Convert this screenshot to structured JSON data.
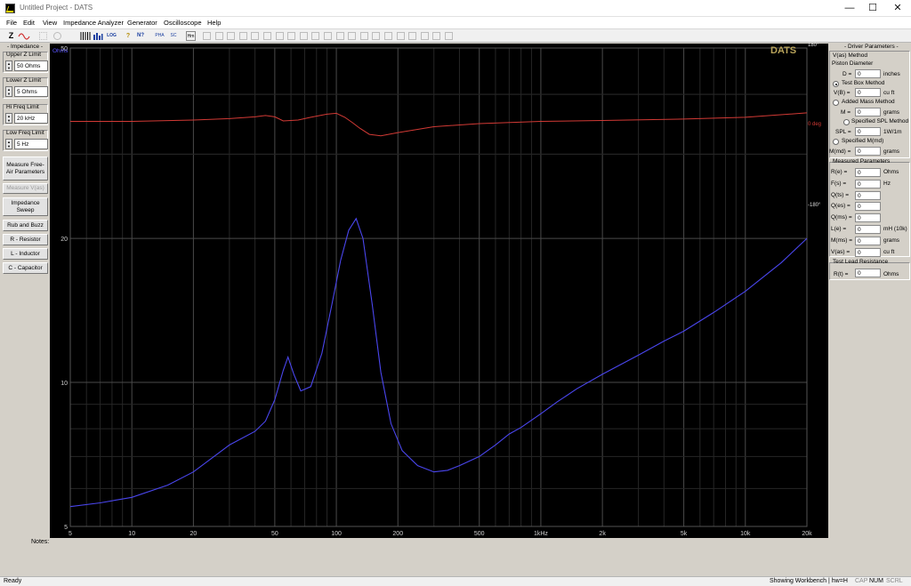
{
  "window": {
    "title": "Untitled Project - DATS",
    "minimize": "—",
    "maximize": "☐",
    "close": "✕"
  },
  "menu": [
    "File",
    "Edit",
    "View",
    "Impedance Analyzer",
    "Generator",
    "Oscilloscope",
    "Help"
  ],
  "toolbar": {
    "z_label": "Z",
    "log_label": "LOG",
    "help_label": "?",
    "whatsthis_label": "N?",
    "phase_label": "PHA",
    "scale_label": "SC",
    "hm_label": "Hm",
    "icons": [
      "impedance-icon",
      "waveform-icon",
      "cursor-icon",
      "zoom-icon",
      "grid-icon",
      "bars-icon",
      "log-icon",
      "help-icon",
      "whats-this-icon",
      "phase-icon",
      "scale-icon",
      "harmonic-icon"
    ]
  },
  "left_panel": {
    "impedance_group": "- Impedance -",
    "upper_z_label": "Upper Z Limit",
    "upper_z_value": "50 Ohms",
    "lower_z_label": "Lower Z Limit",
    "lower_z_value": "5 Ohms",
    "hi_freq_label": "Hi Freq Limit",
    "hi_freq_value": "20 kHz",
    "low_freq_label": "Low Freq Limit",
    "low_freq_value": "5 Hz",
    "buttons": [
      {
        "label": "Measure Free-Air Parameters",
        "enabled": true
      },
      {
        "label": "Measure V(as)",
        "enabled": false
      },
      {
        "label": "Impedance Sweep",
        "enabled": true
      },
      {
        "label": "Rub and Buzz",
        "enabled": true
      },
      {
        "label": "R - Resistor",
        "enabled": true
      },
      {
        "label": "L - Inductor",
        "enabled": true
      },
      {
        "label": "C - Capacitor",
        "enabled": true
      }
    ]
  },
  "right_panel": {
    "driver_title": "- Driver Parameters -",
    "vas_method": "V(as) Method",
    "piston_diameter": "Piston Diameter",
    "d_label": "D =",
    "d_value": "0",
    "d_unit": "inches",
    "test_box": "Test Box Method",
    "vb_label": "V(B) =",
    "vb_value": "0",
    "vb_unit": "cu ft",
    "added_mass": "Added Mass Method",
    "m_label": "M =",
    "m_value": "0",
    "m_unit": "grams",
    "specified_spl": "Specified SPL Method",
    "spl_label": "SPL =",
    "spl_value": "0",
    "spl_unit": "1W/1m",
    "specified_mmd": "Specified M(md)",
    "mmd_label": "M(md) =",
    "mmd_value": "0",
    "mmd_unit": "grams",
    "measured_title": "Measured Parameters",
    "measured": [
      {
        "label": "R(e) =",
        "value": "0",
        "unit": "Ohms"
      },
      {
        "label": "F(s) =",
        "value": "0",
        "unit": "Hz"
      },
      {
        "label": "Q(ts) =",
        "value": "0",
        "unit": ""
      },
      {
        "label": "Q(es) =",
        "value": "0",
        "unit": ""
      },
      {
        "label": "Q(ms) =",
        "value": "0",
        "unit": ""
      },
      {
        "label": "L(e) =",
        "value": "0",
        "unit": "mH (10k)"
      },
      {
        "label": "M(ms) =",
        "value": "0",
        "unit": "grams"
      },
      {
        "label": "V(as) =",
        "value": "0",
        "unit": "cu ft"
      }
    ],
    "test_lead_title": "Test Lead Resistance",
    "rt_label": "R(t) =",
    "rt_value": "0",
    "rt_unit": "Ohms"
  },
  "plot": {
    "brand": "DATS",
    "ohms_label": "Ohms",
    "phase_top": "180°",
    "phase_mid": "0 deg",
    "phase_bottom": "-180°"
  },
  "notes_label": "Notes:",
  "status": {
    "left": "Ready",
    "right": "Showing Workbench | hw=H",
    "cap": "CAP",
    "num": "NUM",
    "scrl": "SCRL"
  },
  "colors": {
    "impedance": "#4a46ee",
    "phase": "#d23a35",
    "brand": "#b8a35a",
    "ohms_label": "#5a55ff"
  },
  "chart_data": {
    "type": "line",
    "x_scale": "log",
    "y_scale": "log",
    "xlim": [
      5,
      20000
    ],
    "ylim": [
      5,
      50
    ],
    "y2lim": [
      -180,
      180
    ],
    "x_ticks": [
      5,
      10,
      20,
      50,
      100,
      200,
      500,
      1000,
      2000,
      5000,
      10000,
      20000
    ],
    "x_tick_labels": [
      "5",
      "10",
      "20",
      "50",
      "100",
      "200",
      "500",
      "1kHz",
      "2k",
      "5k",
      "10k",
      "20k"
    ],
    "y_ticks": [
      5,
      10,
      20,
      50
    ],
    "y_tick_labels": [
      "5",
      "10",
      "20",
      "50"
    ],
    "grid": true,
    "series": [
      {
        "name": "impedance",
        "axis": "y",
        "points": [
          [
            5,
            5.5
          ],
          [
            7,
            5.6
          ],
          [
            10,
            5.75
          ],
          [
            15,
            6.1
          ],
          [
            20,
            6.5
          ],
          [
            30,
            7.4
          ],
          [
            40,
            7.9
          ],
          [
            45,
            8.3
          ],
          [
            50,
            9.2
          ],
          [
            55,
            10.6
          ],
          [
            58,
            11.3
          ],
          [
            62,
            10.4
          ],
          [
            67,
            9.6
          ],
          [
            75,
            9.8
          ],
          [
            85,
            11.5
          ],
          [
            95,
            14.5
          ],
          [
            105,
            18.0
          ],
          [
            115,
            20.8
          ],
          [
            125,
            22.0
          ],
          [
            135,
            20.0
          ],
          [
            150,
            14.5
          ],
          [
            165,
            10.5
          ],
          [
            185,
            8.2
          ],
          [
            210,
            7.2
          ],
          [
            250,
            6.7
          ],
          [
            300,
            6.5
          ],
          [
            350,
            6.55
          ],
          [
            400,
            6.7
          ],
          [
            500,
            7.0
          ],
          [
            600,
            7.4
          ],
          [
            700,
            7.8
          ],
          [
            800,
            8.05
          ],
          [
            1000,
            8.6
          ],
          [
            1200,
            9.1
          ],
          [
            1500,
            9.7
          ],
          [
            2000,
            10.4
          ],
          [
            3000,
            11.4
          ],
          [
            4000,
            12.2
          ],
          [
            5000,
            12.8
          ],
          [
            7000,
            14.0
          ],
          [
            10000,
            15.5
          ],
          [
            15000,
            17.8
          ],
          [
            20000,
            20.0
          ]
        ]
      },
      {
        "name": "phase",
        "axis": "y2",
        "points": [
          [
            5,
            5
          ],
          [
            10,
            5
          ],
          [
            20,
            8
          ],
          [
            30,
            11
          ],
          [
            40,
            15
          ],
          [
            45,
            18
          ],
          [
            50,
            15
          ],
          [
            55,
            6
          ],
          [
            65,
            8
          ],
          [
            75,
            14
          ],
          [
            90,
            21
          ],
          [
            100,
            23
          ],
          [
            110,
            14
          ],
          [
            120,
            2
          ],
          [
            130,
            -10
          ],
          [
            145,
            -24
          ],
          [
            165,
            -27
          ],
          [
            200,
            -20
          ],
          [
            300,
            -7
          ],
          [
            500,
            0
          ],
          [
            1000,
            5
          ],
          [
            2000,
            7
          ],
          [
            5000,
            10
          ],
          [
            10000,
            14
          ],
          [
            20000,
            24
          ]
        ]
      }
    ]
  }
}
